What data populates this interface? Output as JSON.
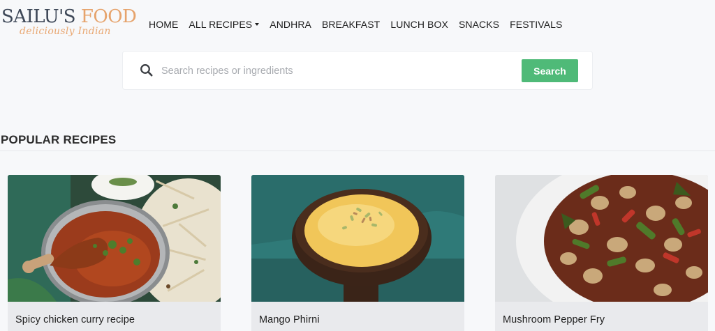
{
  "logo": {
    "name_part_a": "SAILU'S",
    "name_part_b": "FOOD",
    "tagline": "deliciously Indian"
  },
  "nav": {
    "items": [
      {
        "label": "HOME",
        "has_dropdown": false
      },
      {
        "label": "ALL RECIPES",
        "has_dropdown": true
      },
      {
        "label": "ANDHRA",
        "has_dropdown": false
      },
      {
        "label": "BREAKFAST",
        "has_dropdown": false
      },
      {
        "label": "LUNCH BOX",
        "has_dropdown": false
      },
      {
        "label": "SNACKS",
        "has_dropdown": false
      },
      {
        "label": "FESTIVALS",
        "has_dropdown": false
      }
    ]
  },
  "search": {
    "placeholder": "Search recipes or ingredients",
    "value": "",
    "button_label": "Search",
    "icon": "search-icon"
  },
  "popular": {
    "title": "POPULAR RECIPES",
    "cards": [
      {
        "title": "Spicy chicken curry recipe",
        "image": "chicken-curry-photo"
      },
      {
        "title": "Mango Phirni",
        "image": "mango-phirni-photo"
      },
      {
        "title": "Mushroom Pepper Fry",
        "image": "mushroom-pepper-fry-photo"
      }
    ]
  },
  "colors": {
    "page_background": "#f7f8fa",
    "search_button": "#4fba78",
    "logo_dark": "#3d4757",
    "logo_accent": "#e6a36c",
    "card_footer": "#e9eaed"
  }
}
